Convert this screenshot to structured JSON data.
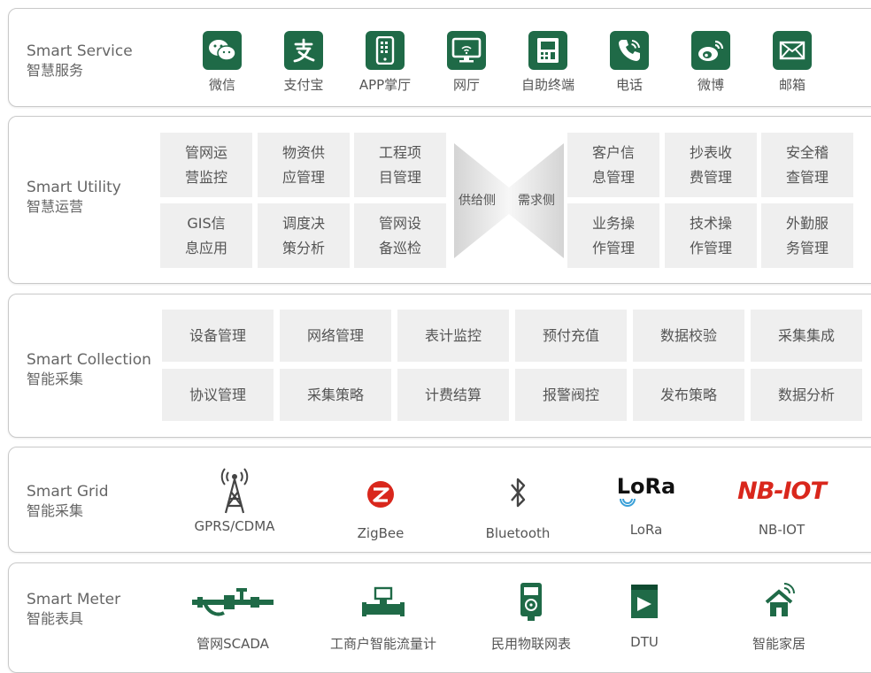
{
  "sections": {
    "service": {
      "en": "Smart Service",
      "zh": "智慧服务",
      "items": [
        {
          "label": "微信",
          "icon": "wechat-icon"
        },
        {
          "label": "支付宝",
          "icon": "alipay-icon"
        },
        {
          "label": "APP掌厅",
          "icon": "mobile-app-icon"
        },
        {
          "label": "网厅",
          "icon": "monitor-icon"
        },
        {
          "label": "自助终端",
          "icon": "atm-terminal-icon"
        },
        {
          "label": "电话",
          "icon": "phone-icon"
        },
        {
          "label": "微博",
          "icon": "weibo-icon"
        },
        {
          "label": "邮箱",
          "icon": "mail-icon"
        }
      ]
    },
    "utility": {
      "en": "Smart Utility",
      "zh": "智慧运营",
      "supply_label": "供给侧",
      "demand_label": "需求侧",
      "left": [
        {
          "l1": "管网运",
          "l2": "营监控"
        },
        {
          "l1": "物资供",
          "l2": "应管理"
        },
        {
          "l1": "工程项",
          "l2": "目管理"
        },
        {
          "l1": "GIS信",
          "l2": "息应用"
        },
        {
          "l1": "调度决",
          "l2": "策分析"
        },
        {
          "l1": "管网设",
          "l2": "备巡检"
        }
      ],
      "right": [
        {
          "l1": "客户信",
          "l2": "息管理"
        },
        {
          "l1": "抄表收",
          "l2": "费管理"
        },
        {
          "l1": "安全稽",
          "l2": "查管理"
        },
        {
          "l1": "业务操",
          "l2": "作管理"
        },
        {
          "l1": "技术操",
          "l2": "作管理"
        },
        {
          "l1": "外勤服",
          "l2": "务管理"
        }
      ]
    },
    "collection": {
      "en": "Smart Collection",
      "zh": "智能采集",
      "row1": [
        "设备管理",
        "网络管理",
        "表计监控",
        "预付充值",
        "数据校验",
        "采集集成"
      ],
      "row2": [
        "协议管理",
        "采集策略",
        "计费结算",
        "报警阀控",
        "发布策略",
        "数据分析"
      ]
    },
    "grid": {
      "en": "Smart Grid",
      "zh": "智能采集",
      "items": [
        {
          "label": "GPRS/CDMA",
          "icon": "antenna-tower-icon"
        },
        {
          "label": "ZigBee",
          "icon": "zigbee-icon"
        },
        {
          "label": "Bluetooth",
          "icon": "bluetooth-icon"
        },
        {
          "label": "LoRa",
          "icon": "lora-logo",
          "logo": "LoRa"
        },
        {
          "label": "NB-IOT",
          "icon": "nb-iot-logo",
          "logo": "NB-IOT"
        }
      ]
    },
    "meter": {
      "en": "Smart Meter",
      "zh": "智能表具",
      "items": [
        {
          "label": "管网SCADA",
          "icon": "pipeline-icon"
        },
        {
          "label": "工商户智能流量计",
          "icon": "flow-meter-icon"
        },
        {
          "label": "民用物联网表",
          "icon": "household-meter-icon"
        },
        {
          "label": "DTU",
          "icon": "dtu-icon"
        },
        {
          "label": "智能家居",
          "icon": "smart-home-icon"
        }
      ]
    }
  },
  "colors": {
    "accent": "#1f6a47",
    "red": "#d9271c",
    "tile_bg": "#efefef",
    "border": "#c9c9c9"
  }
}
